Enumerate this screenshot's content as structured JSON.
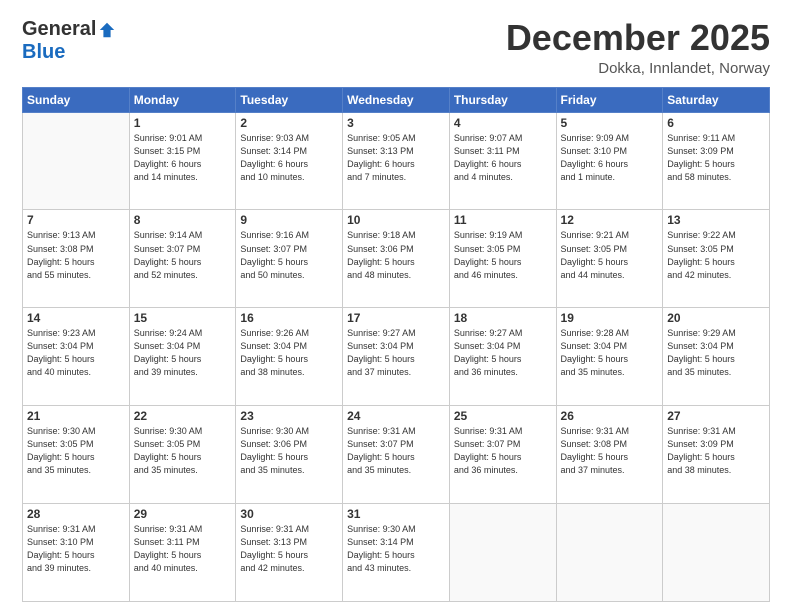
{
  "logo": {
    "general": "General",
    "blue": "Blue"
  },
  "header": {
    "month": "December 2025",
    "location": "Dokka, Innlandet, Norway"
  },
  "weekdays": [
    "Sunday",
    "Monday",
    "Tuesday",
    "Wednesday",
    "Thursday",
    "Friday",
    "Saturday"
  ],
  "weeks": [
    [
      {
        "day": "",
        "info": ""
      },
      {
        "day": "1",
        "info": "Sunrise: 9:01 AM\nSunset: 3:15 PM\nDaylight: 6 hours\nand 14 minutes."
      },
      {
        "day": "2",
        "info": "Sunrise: 9:03 AM\nSunset: 3:14 PM\nDaylight: 6 hours\nand 10 minutes."
      },
      {
        "day": "3",
        "info": "Sunrise: 9:05 AM\nSunset: 3:13 PM\nDaylight: 6 hours\nand 7 minutes."
      },
      {
        "day": "4",
        "info": "Sunrise: 9:07 AM\nSunset: 3:11 PM\nDaylight: 6 hours\nand 4 minutes."
      },
      {
        "day": "5",
        "info": "Sunrise: 9:09 AM\nSunset: 3:10 PM\nDaylight: 6 hours\nand 1 minute."
      },
      {
        "day": "6",
        "info": "Sunrise: 9:11 AM\nSunset: 3:09 PM\nDaylight: 5 hours\nand 58 minutes."
      }
    ],
    [
      {
        "day": "7",
        "info": "Sunrise: 9:13 AM\nSunset: 3:08 PM\nDaylight: 5 hours\nand 55 minutes."
      },
      {
        "day": "8",
        "info": "Sunrise: 9:14 AM\nSunset: 3:07 PM\nDaylight: 5 hours\nand 52 minutes."
      },
      {
        "day": "9",
        "info": "Sunrise: 9:16 AM\nSunset: 3:07 PM\nDaylight: 5 hours\nand 50 minutes."
      },
      {
        "day": "10",
        "info": "Sunrise: 9:18 AM\nSunset: 3:06 PM\nDaylight: 5 hours\nand 48 minutes."
      },
      {
        "day": "11",
        "info": "Sunrise: 9:19 AM\nSunset: 3:05 PM\nDaylight: 5 hours\nand 46 minutes."
      },
      {
        "day": "12",
        "info": "Sunrise: 9:21 AM\nSunset: 3:05 PM\nDaylight: 5 hours\nand 44 minutes."
      },
      {
        "day": "13",
        "info": "Sunrise: 9:22 AM\nSunset: 3:05 PM\nDaylight: 5 hours\nand 42 minutes."
      }
    ],
    [
      {
        "day": "14",
        "info": "Sunrise: 9:23 AM\nSunset: 3:04 PM\nDaylight: 5 hours\nand 40 minutes."
      },
      {
        "day": "15",
        "info": "Sunrise: 9:24 AM\nSunset: 3:04 PM\nDaylight: 5 hours\nand 39 minutes."
      },
      {
        "day": "16",
        "info": "Sunrise: 9:26 AM\nSunset: 3:04 PM\nDaylight: 5 hours\nand 38 minutes."
      },
      {
        "day": "17",
        "info": "Sunrise: 9:27 AM\nSunset: 3:04 PM\nDaylight: 5 hours\nand 37 minutes."
      },
      {
        "day": "18",
        "info": "Sunrise: 9:27 AM\nSunset: 3:04 PM\nDaylight: 5 hours\nand 36 minutes."
      },
      {
        "day": "19",
        "info": "Sunrise: 9:28 AM\nSunset: 3:04 PM\nDaylight: 5 hours\nand 35 minutes."
      },
      {
        "day": "20",
        "info": "Sunrise: 9:29 AM\nSunset: 3:04 PM\nDaylight: 5 hours\nand 35 minutes."
      }
    ],
    [
      {
        "day": "21",
        "info": "Sunrise: 9:30 AM\nSunset: 3:05 PM\nDaylight: 5 hours\nand 35 minutes."
      },
      {
        "day": "22",
        "info": "Sunrise: 9:30 AM\nSunset: 3:05 PM\nDaylight: 5 hours\nand 35 minutes."
      },
      {
        "day": "23",
        "info": "Sunrise: 9:30 AM\nSunset: 3:06 PM\nDaylight: 5 hours\nand 35 minutes."
      },
      {
        "day": "24",
        "info": "Sunrise: 9:31 AM\nSunset: 3:07 PM\nDaylight: 5 hours\nand 35 minutes."
      },
      {
        "day": "25",
        "info": "Sunrise: 9:31 AM\nSunset: 3:07 PM\nDaylight: 5 hours\nand 36 minutes."
      },
      {
        "day": "26",
        "info": "Sunrise: 9:31 AM\nSunset: 3:08 PM\nDaylight: 5 hours\nand 37 minutes."
      },
      {
        "day": "27",
        "info": "Sunrise: 9:31 AM\nSunset: 3:09 PM\nDaylight: 5 hours\nand 38 minutes."
      }
    ],
    [
      {
        "day": "28",
        "info": "Sunrise: 9:31 AM\nSunset: 3:10 PM\nDaylight: 5 hours\nand 39 minutes."
      },
      {
        "day": "29",
        "info": "Sunrise: 9:31 AM\nSunset: 3:11 PM\nDaylight: 5 hours\nand 40 minutes."
      },
      {
        "day": "30",
        "info": "Sunrise: 9:31 AM\nSunset: 3:13 PM\nDaylight: 5 hours\nand 42 minutes."
      },
      {
        "day": "31",
        "info": "Sunrise: 9:30 AM\nSunset: 3:14 PM\nDaylight: 5 hours\nand 43 minutes."
      },
      {
        "day": "",
        "info": ""
      },
      {
        "day": "",
        "info": ""
      },
      {
        "day": "",
        "info": ""
      }
    ]
  ]
}
